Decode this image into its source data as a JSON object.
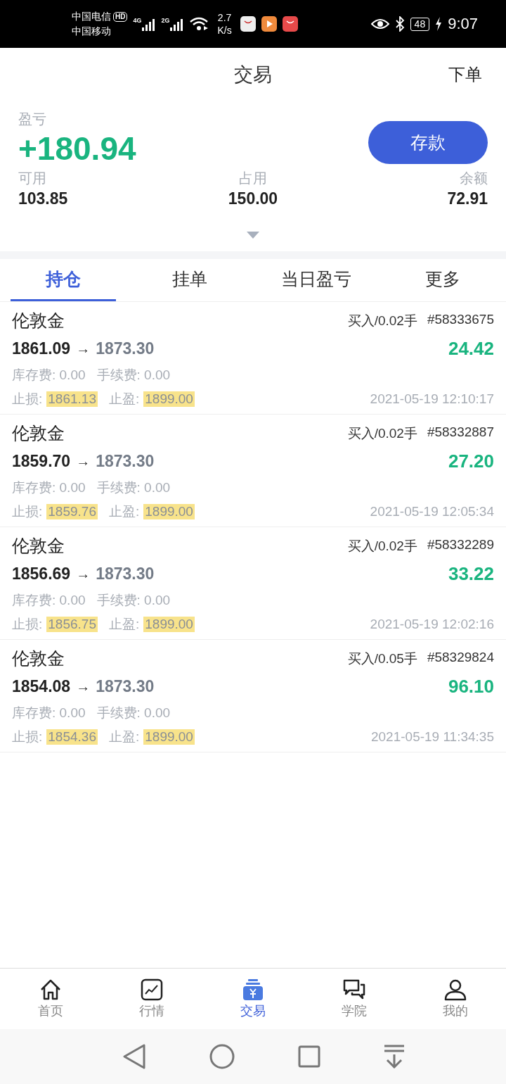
{
  "status_bar": {
    "carrier_1": "中国电信",
    "hd": "HD",
    "carrier_2": "中国移动",
    "net_1": "4G",
    "net_2": "2G",
    "speed_value": "2.7",
    "speed_unit": "K/s",
    "battery": "48",
    "time": "9:07"
  },
  "header": {
    "title": "交易",
    "action": "下单"
  },
  "summary": {
    "pnl_label": "盈亏",
    "pnl": "+180.94",
    "deposit_button": "存款",
    "stats": [
      {
        "label": "可用",
        "value": "103.85"
      },
      {
        "label": "占用",
        "value": "150.00"
      },
      {
        "label": "余额",
        "value": "72.91"
      }
    ]
  },
  "tabs": [
    {
      "label": "持仓",
      "selected": true
    },
    {
      "label": "挂单",
      "selected": false
    },
    {
      "label": "当日盈亏",
      "selected": false
    },
    {
      "label": "更多",
      "selected": false
    }
  ],
  "positions": [
    {
      "name": "伦敦金",
      "side": "买入/0.02手",
      "order": "#58333675",
      "open": "1861.09",
      "arrow": "→",
      "current": "1873.30",
      "profit": "24.42",
      "swap": "库存费: 0.00",
      "fee": "手续费: 0.00",
      "sl_label": "止损:",
      "sl": "1861.13",
      "tp_label": "止盈:",
      "tp": "1899.00",
      "time": "2021-05-19 12:10:17"
    },
    {
      "name": "伦敦金",
      "side": "买入/0.02手",
      "order": "#58332887",
      "open": "1859.70",
      "arrow": "→",
      "current": "1873.30",
      "profit": "27.20",
      "swap": "库存费: 0.00",
      "fee": "手续费: 0.00",
      "sl_label": "止损:",
      "sl": "1859.76",
      "tp_label": "止盈:",
      "tp": "1899.00",
      "time": "2021-05-19 12:05:34"
    },
    {
      "name": "伦敦金",
      "side": "买入/0.02手",
      "order": "#58332289",
      "open": "1856.69",
      "arrow": "→",
      "current": "1873.30",
      "profit": "33.22",
      "swap": "库存费: 0.00",
      "fee": "手续费: 0.00",
      "sl_label": "止损:",
      "sl": "1856.75",
      "tp_label": "止盈:",
      "tp": "1899.00",
      "time": "2021-05-19 12:02:16"
    },
    {
      "name": "伦敦金",
      "side": "买入/0.05手",
      "order": "#58329824",
      "open": "1854.08",
      "arrow": "→",
      "current": "1873.30",
      "profit": "96.10",
      "swap": "库存费: 0.00",
      "fee": "手续费: 0.00",
      "sl_label": "止损:",
      "sl": "1854.36",
      "tp_label": "止盈:",
      "tp": "1899.00",
      "time": "2021-05-19 11:34:35"
    }
  ],
  "bottom_nav": [
    {
      "label": "首页",
      "kind": "home",
      "selected": false
    },
    {
      "label": "行情",
      "kind": "chart",
      "selected": false
    },
    {
      "label": "交易",
      "kind": "trade",
      "selected": true
    },
    {
      "label": "学院",
      "kind": "chat",
      "selected": false
    },
    {
      "label": "我的",
      "kind": "user",
      "selected": false
    }
  ]
}
